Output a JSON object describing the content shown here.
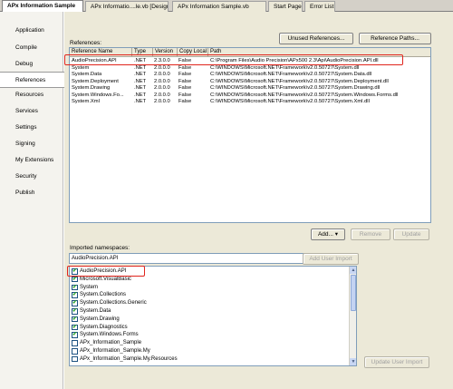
{
  "tabs": [
    {
      "label": "APx Information Sample",
      "active": true
    },
    {
      "label": "APx Informatio....le.vb [Design]",
      "active": false
    },
    {
      "label": "APx Information Sample.vb",
      "active": false
    },
    {
      "label": "Start Page",
      "active": false
    },
    {
      "label": "Error List",
      "active": false
    }
  ],
  "nav": [
    {
      "label": "Application",
      "active": false
    },
    {
      "label": "Compile",
      "active": false
    },
    {
      "label": "Debug",
      "active": false
    },
    {
      "label": "References",
      "active": true
    },
    {
      "label": "Resources",
      "active": false
    },
    {
      "label": "Services",
      "active": false
    },
    {
      "label": "Settings",
      "active": false
    },
    {
      "label": "Signing",
      "active": false
    },
    {
      "label": "My Extensions",
      "active": false
    },
    {
      "label": "Security",
      "active": false
    },
    {
      "label": "Publish",
      "active": false
    }
  ],
  "references": {
    "label": "References:",
    "unused_button": "Unused References...",
    "paths_button": "Reference Paths...",
    "columns": [
      "Reference Name",
      "Type",
      "Version",
      "Copy Local",
      "Path"
    ],
    "rows": [
      [
        "AudioPrecision.API",
        ".NET",
        "2.3.0.0",
        "False",
        "C:\\Program Files\\Audio Precision\\APx500 2.3\\Api\\AudioPrecision.API.dll"
      ],
      [
        "System",
        ".NET",
        "2.0.0.0",
        "False",
        "C:\\WINDOWS\\Microsoft.NET\\Framework\\v2.0.50727\\System.dll"
      ],
      [
        "System.Data",
        ".NET",
        "2.0.0.0",
        "False",
        "C:\\WINDOWS\\Microsoft.NET\\Framework\\v2.0.50727\\System.Data.dll"
      ],
      [
        "System.Deployment",
        ".NET",
        "2.0.0.0",
        "False",
        "C:\\WINDOWS\\Microsoft.NET\\Framework\\v2.0.50727\\System.Deployment.dll"
      ],
      [
        "System.Drawing",
        ".NET",
        "2.0.0.0",
        "False",
        "C:\\WINDOWS\\Microsoft.NET\\Framework\\v2.0.50727\\System.Drawing.dll"
      ],
      [
        "System.Windows.Fo...",
        ".NET",
        "2.0.0.0",
        "False",
        "C:\\WINDOWS\\Microsoft.NET\\Framework\\v2.0.50727\\System.Windows.Forms.dll"
      ],
      [
        "System.Xml",
        ".NET",
        "2.0.0.0",
        "False",
        "C:\\WINDOWS\\Microsoft.NET\\Framework\\v2.0.50727\\System.Xml.dll"
      ]
    ],
    "add_button": "Add...",
    "remove_button": "Remove",
    "update_button": "Update"
  },
  "imports": {
    "label": "Imported namespaces:",
    "input_value": "AudioPrecision.API",
    "add_import_button": "Add User Import",
    "update_import_button": "Update User Import",
    "items": [
      {
        "label": "AudioPrecision.API",
        "checked": true
      },
      {
        "label": "Microsoft.VisualBasic",
        "checked": true
      },
      {
        "label": "System",
        "checked": true
      },
      {
        "label": "System.Collections",
        "checked": true
      },
      {
        "label": "System.Collections.Generic",
        "checked": true
      },
      {
        "label": "System.Data",
        "checked": true
      },
      {
        "label": "System.Drawing",
        "checked": true
      },
      {
        "label": "System.Diagnostics",
        "checked": true
      },
      {
        "label": "System.Windows.Forms",
        "checked": true
      },
      {
        "label": "APx_Information_Sample",
        "checked": false
      },
      {
        "label": "APx_Information_Sample.My",
        "checked": false
      },
      {
        "label": "APx_Information_Sample.My.Resources",
        "checked": false
      }
    ]
  },
  "colors": {
    "highlight_box": "#e0241c",
    "check": "#21a121"
  }
}
